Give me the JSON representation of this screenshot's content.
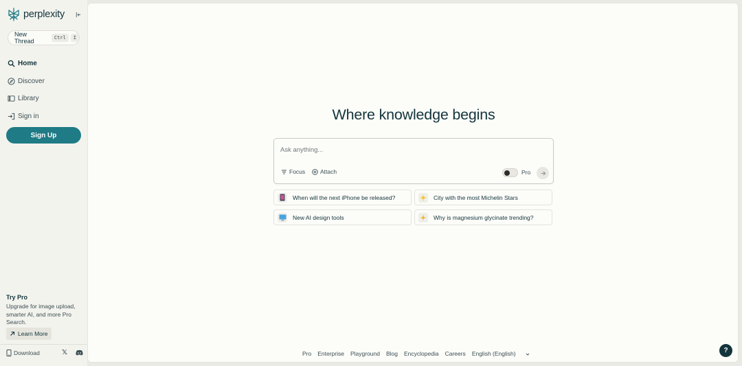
{
  "brand": {
    "name": "perplexity",
    "accent": "#1f7b85"
  },
  "sidebar": {
    "new_thread": {
      "label": "New Thread",
      "kbd1": "Ctrl",
      "kbd2": "I"
    },
    "items": [
      {
        "label": "Home",
        "icon": "search-icon"
      },
      {
        "label": "Discover",
        "icon": "compass-icon"
      },
      {
        "label": "Library",
        "icon": "library-icon"
      },
      {
        "label": "Sign in",
        "icon": "sign-in-icon"
      }
    ],
    "signup_label": "Sign Up",
    "try_pro": {
      "title": "Try Pro",
      "description": "Upgrade for image upload, smarter AI, and more Pro Search.",
      "learn_more": "Learn More"
    },
    "download_label": "Download"
  },
  "main": {
    "headline": "Where knowledge begins",
    "ask": {
      "placeholder": "Ask anything...",
      "focus_label": "Focus",
      "attach_label": "Attach",
      "pro_label": "Pro",
      "pro_enabled": false
    },
    "suggestions": [
      {
        "label": "When will the next iPhone be released?",
        "icon": "phone-emoji"
      },
      {
        "label": "City with the most Michelin Stars",
        "icon": "star-emoji"
      },
      {
        "label": "New AI design tools",
        "icon": "computer-emoji"
      },
      {
        "label": "Why is magnesium glycinate trending?",
        "icon": "sparkle-emoji"
      }
    ]
  },
  "footer": {
    "links": [
      "Pro",
      "Enterprise",
      "Playground",
      "Blog",
      "Encyclopedia",
      "Careers"
    ],
    "language": "English (English)"
  },
  "help_label": "?"
}
